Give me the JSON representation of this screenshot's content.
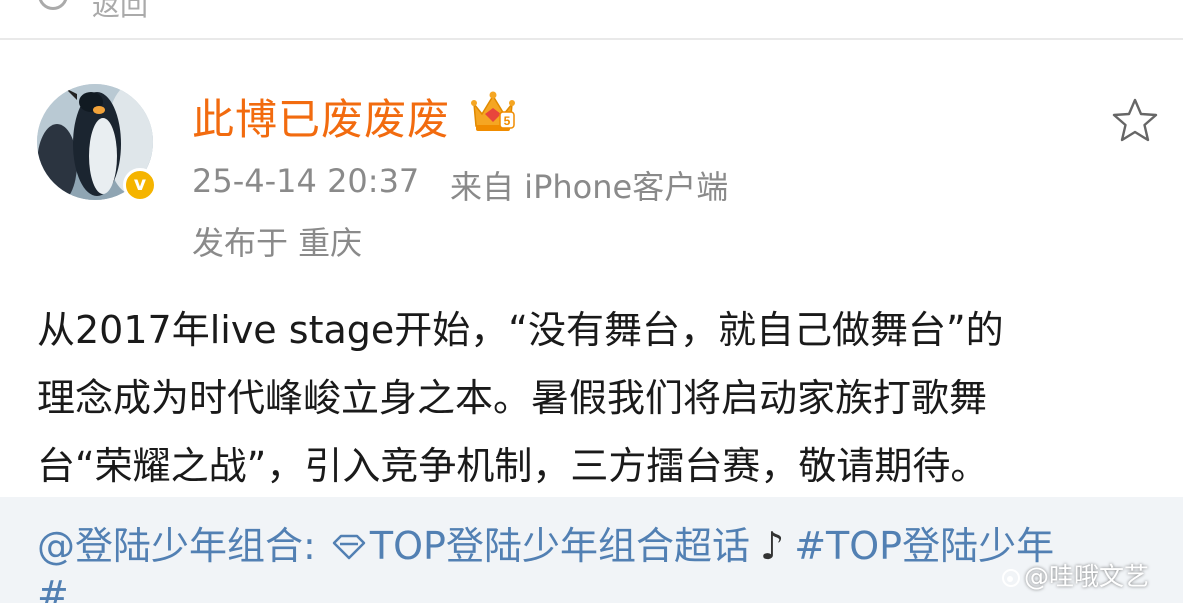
{
  "topbar": {
    "back_label": "返回"
  },
  "post": {
    "author": {
      "name": "此博已废废废",
      "verified_mark": "v",
      "vip_level": "5"
    },
    "time": "25-4-14 20:37",
    "source": "来自 iPhone客户端",
    "location": "发布于 重庆",
    "body_lines": [
      "从2017年live stage开始，“没有舞台，就自己做舞台”的",
      "理念成为时代峰峻立身之本。暑假我们将启动家族打歌舞",
      "台“荣耀之战”，引入竞争机制，三方擂台赛，敬请期待。"
    ]
  },
  "repost": {
    "mention": "@登陆少年组合:",
    "supertopic": "TOP登陆少年组合超话",
    "note": "♪",
    "hashtag_start": "#TOP登陆少年",
    "hashtag_end": "#"
  },
  "watermark": "@哇哦文艺",
  "colors": {
    "username": "#f26b0f",
    "link": "#5280b3",
    "meta": "#8a8a8a",
    "repost_bg": "#f1f4f7",
    "badge": "#f5b400"
  },
  "icons": {
    "crown": "vip-crown-icon",
    "star": "favorite-star-icon",
    "gem": "supertopic-diamond-icon",
    "verified": "verified-badge-icon"
  }
}
